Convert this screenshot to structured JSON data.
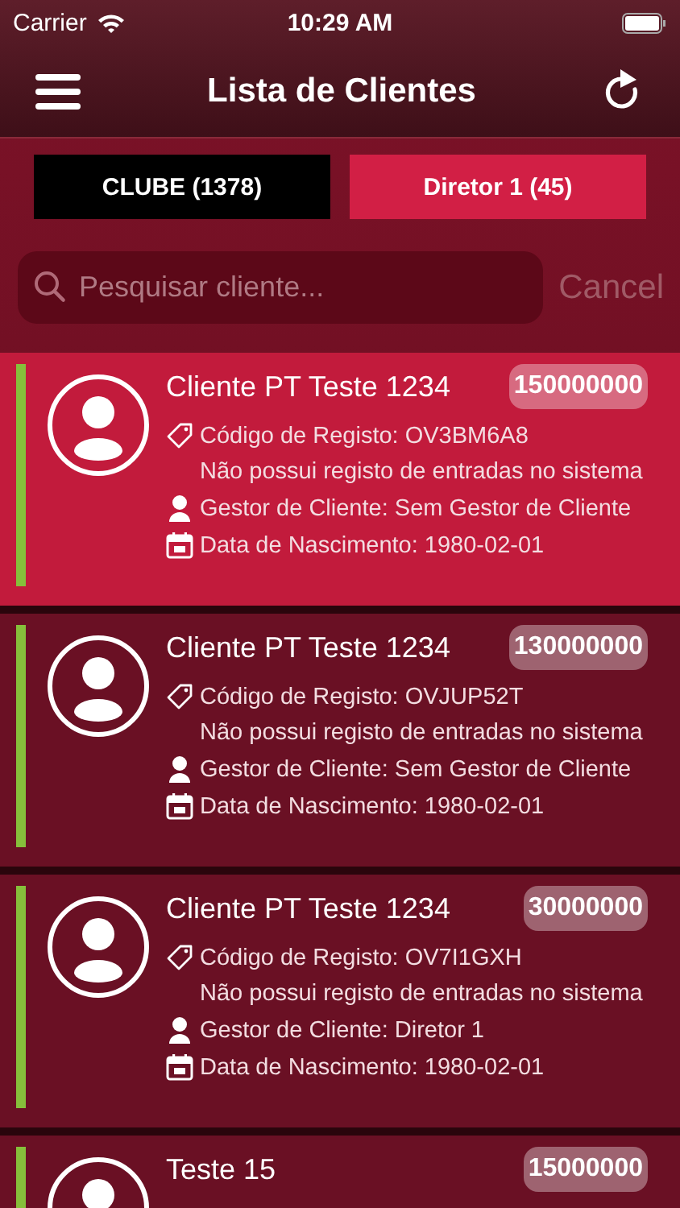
{
  "status_bar": {
    "carrier": "Carrier",
    "time": "10:29 AM"
  },
  "nav": {
    "title": "Lista de Clientes"
  },
  "tabs": [
    {
      "label": "CLUBE (1378)",
      "selected": false
    },
    {
      "label": "Diretor 1 (45)",
      "selected": true
    }
  ],
  "search": {
    "placeholder": "Pesquisar cliente...",
    "cancel": "Cancel"
  },
  "clients": [
    {
      "name": "Cliente PT Teste 1234",
      "badge": "150000000",
      "selected": true,
      "code": "Código de Registo: OV3BM6A8",
      "entries": "Não possui registo de entradas no sistema",
      "manager": "Gestor de Cliente: Sem Gestor de Cliente",
      "birth": "Data de Nascimento: 1980-02-01"
    },
    {
      "name": "Cliente PT Teste 1234",
      "badge": "130000000",
      "selected": false,
      "code": "Código de Registo: OVJUP52T",
      "entries": "Não possui registo de entradas no sistema",
      "manager": "Gestor de Cliente: Sem Gestor de Cliente",
      "birth": "Data de Nascimento: 1980-02-01"
    },
    {
      "name": "Cliente PT Teste 1234",
      "badge": "30000000",
      "selected": false,
      "code": "Código de Registo: OV7I1GXH",
      "entries": "Não possui registo de entradas no sistema",
      "manager": "Gestor de Cliente: Diretor 1",
      "birth": "Data de Nascimento: 1980-02-01"
    },
    {
      "name": "Teste 15",
      "badge": "15000000",
      "selected": false
    }
  ]
}
